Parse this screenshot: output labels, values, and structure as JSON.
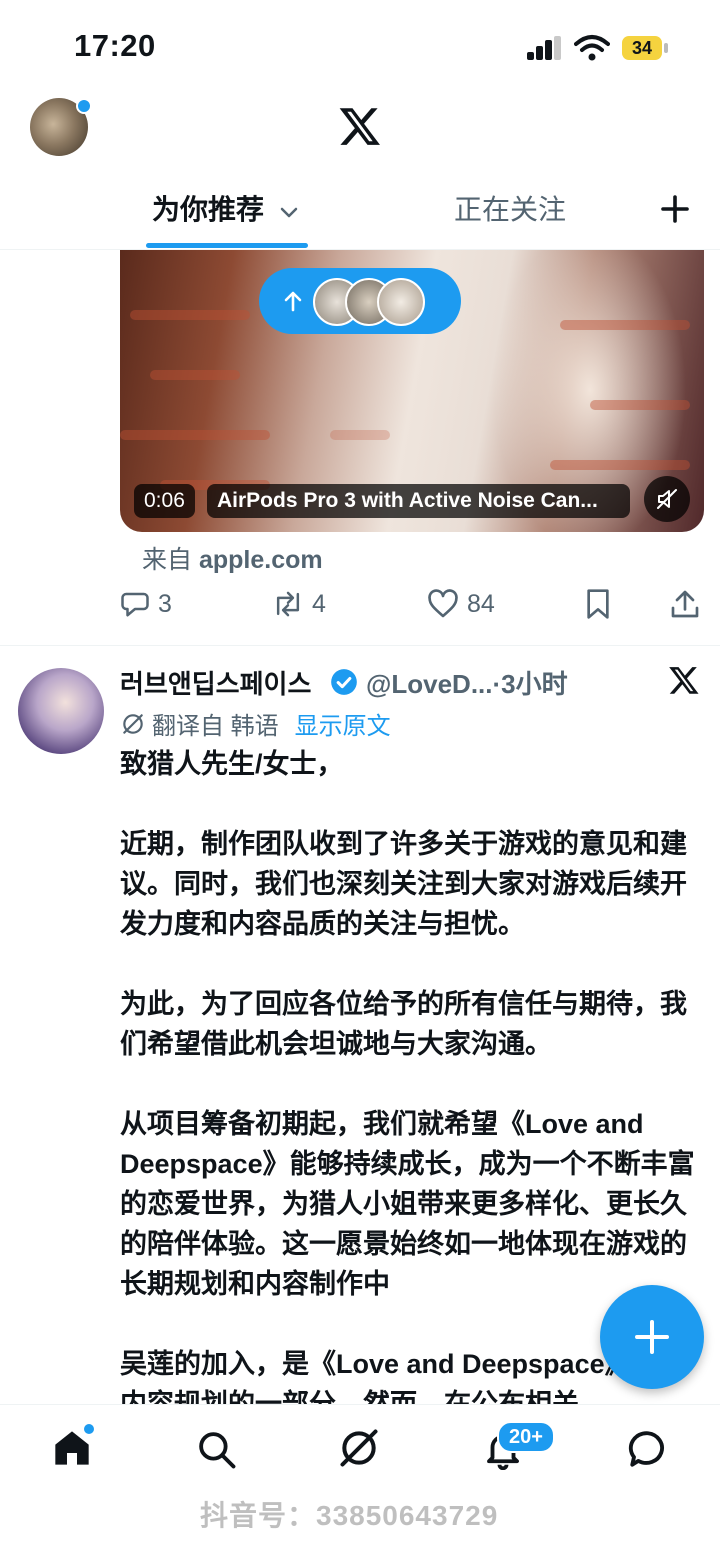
{
  "status_bar": {
    "time": "17:20",
    "battery": "34"
  },
  "header": {
    "logo": "x-logo-icon"
  },
  "tabs": [
    {
      "label": "为你推荐",
      "active": true
    },
    {
      "label": "正在关注",
      "active": false
    }
  ],
  "video_post": {
    "duration": "0:06",
    "title": "AirPods Pro 3 with Active Noise Can...",
    "source_prefix": "来自",
    "source_domain": "apple.com",
    "actions": {
      "replies": "3",
      "reposts": "4",
      "likes": "84"
    }
  },
  "post": {
    "author": "러브앤딥스페이스",
    "handle": "@LoveD...",
    "time": "·3小时",
    "translated_label": "翻译自 韩语",
    "show_original": "显示原文",
    "paragraphs": [
      "致猎人先生/女士，",
      "近期，制作团队收到了许多关于游戏的意见和建议。同时，我们也深刻关注到大家对游戏后续开发力度和内容品质的关注与担忧。",
      "为此，为了回应各位给予的所有信任与期待，我们希望借此机会坦诚地与大家沟通。",
      "从项目筹备初期起，我们就希望《Love and Deepspace》能够持续成长，成为一个不断丰富的恋爱世界，为猎人小姐带来更多样化、更长久的陪伴体验。这一愿景始终如一地体现在游戏的长期规划和内容制作中",
      "吴莲的加入，是《Love and Deepspace》长期内容规划的一部分。然而，在公布相关"
    ]
  },
  "bottom_nav": {
    "notifications_badge": "20+"
  },
  "watermark": "抖音号：33850643729",
  "colors": {
    "accent": "#1d9bf0",
    "text": "#0f1419",
    "muted": "#536471"
  }
}
